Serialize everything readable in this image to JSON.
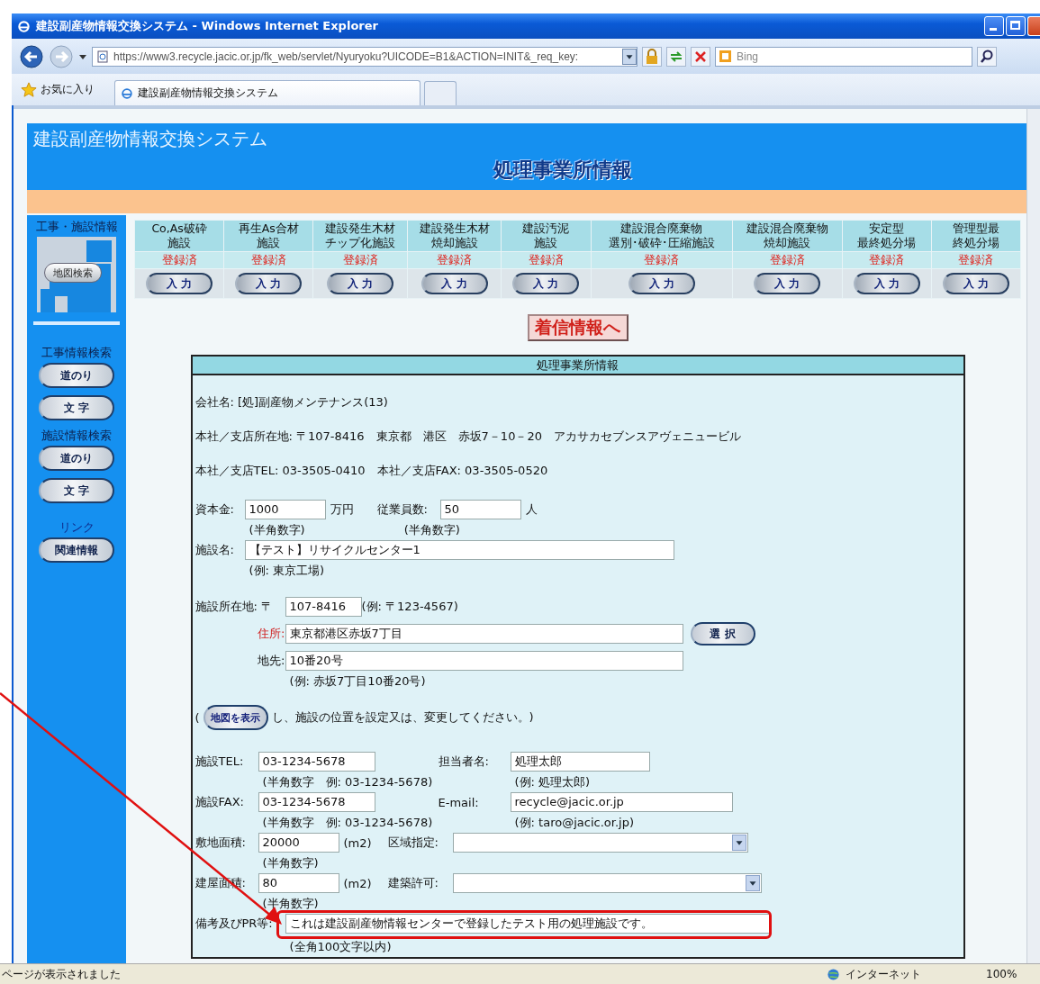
{
  "window": {
    "title": "建設副産物情報交換システム - Windows Internet Explorer"
  },
  "address_bar": {
    "url": "https://www3.recycle.jacic.or.jp/fk_web/servlet/Nyuryoku?UICODE=B1&ACTION=INIT&_req_key:",
    "search_placeholder": "Bing"
  },
  "favorites_bar": {
    "favorites": "お気に入り",
    "tabs": [
      {
        "label": "建設副産物情報交換システム",
        "selected": true
      }
    ]
  },
  "page": {
    "system_name": "建設副産物情報交換システム",
    "title": "処理事業所情報"
  },
  "sidebar": {
    "heading": "工事・施設情報",
    "map_button": "地図検索",
    "sections": [
      {
        "heading": "工事情報検索",
        "kind": "search",
        "buttons": [
          "道のり",
          "文 字"
        ]
      },
      {
        "heading": "施設情報検索",
        "kind": "search",
        "buttons": [
          "道のり",
          "文 字"
        ]
      },
      {
        "heading": "リンク",
        "kind": "link",
        "buttons": [
          "関連情報"
        ]
      }
    ]
  },
  "facility_types": [
    {
      "lines": [
        "Co,As破砕",
        "施設"
      ],
      "status": "登録済",
      "button": "入 力"
    },
    {
      "lines": [
        "再生As合材",
        "施設"
      ],
      "status": "登録済",
      "button": "入 力"
    },
    {
      "lines": [
        "建設発生木材",
        "チップ化施設"
      ],
      "status": "登録済",
      "button": "入 力"
    },
    {
      "lines": [
        "建設発生木材",
        "焼却施設"
      ],
      "status": "登録済",
      "button": "入 力"
    },
    {
      "lines": [
        "建設汚泥",
        "施設"
      ],
      "status": "登録済",
      "button": "入 力"
    },
    {
      "lines": [
        "建設混合廃棄物",
        "選別･破砕･圧縮施設"
      ],
      "status": "登録済",
      "button": "入 力"
    },
    {
      "lines": [
        "建設混合廃棄物",
        "焼却施設"
      ],
      "status": "登録済",
      "button": "入 力"
    },
    {
      "lines": [
        "安定型",
        "最終処分場"
      ],
      "status": "登録済",
      "button": "入 力"
    },
    {
      "lines": [
        "管理型最",
        "終処分場"
      ],
      "status": "登録済",
      "button": "入 力"
    }
  ],
  "incoming_button": "着信情報へ",
  "form": {
    "title": "処理事業所情報",
    "info_lines": [
      "会社名: [処]副産物メンテナンス(13)",
      "本社／支店所在地: 〒107-8416　東京都　港区　赤坂7－10－20　アカサカセブンスアヴェニュービル",
      "本社／支店TEL: 03-3505-0410　本社／支店FAX: 03-3505-0520"
    ],
    "capital": {
      "label": "資本金:",
      "value": "1000",
      "unit": "万円",
      "hint": "(半角数字)"
    },
    "employees": {
      "label": "従業員数:",
      "value": "50",
      "unit": "人",
      "hint": "(半角数字)"
    },
    "facility_name": {
      "label": "施設名:",
      "value": "【テスト】リサイクルセンター1",
      "hint": "(例: 東京工場)"
    },
    "postal": {
      "label": "施設所在地: 〒",
      "value": "107-8416",
      "hint": "(例: 〒123-4567)"
    },
    "address": {
      "label": "住所:",
      "value": "東京都港区赤坂7丁目",
      "button": "選 択",
      "required": true
    },
    "address_detail": {
      "label": "地先:",
      "value": "10番20号",
      "hint": "(例: 赤坂7丁目10番20号)"
    },
    "map_note": {
      "open": "(",
      "button": "地図を表示",
      "text": "し、施設の位置を設定又は、変更してください。)"
    },
    "tel": {
      "label": "施設TEL:",
      "value": "03-1234-5678",
      "hint": "(半角数字　例: 03-1234-5678)"
    },
    "contact": {
      "label": "担当者名:",
      "value": "処理太郎",
      "hint": "(例: 処理太郎)"
    },
    "fax": {
      "label": "施設FAX:",
      "value": "03-1234-5678",
      "hint": "(半角数字　例: 03-1234-5678)"
    },
    "email": {
      "label": "E-mail:",
      "value": "recycle@jacic.or.jp",
      "hint": "(例: taro@jacic.or.jp)"
    },
    "site_area": {
      "label": "敷地面積:",
      "value": "20000",
      "unit": "(m2)",
      "hint": "(半角数字)"
    },
    "zoning": {
      "label": "区域指定:"
    },
    "building_area": {
      "label": "建屋面積:",
      "value": "80",
      "unit": "(m2)",
      "hint": "(半角数字)"
    },
    "building_permit": {
      "label": "建築許可:"
    },
    "remarks": {
      "label": "備考及びPR等:",
      "value": "これは建設副産物情報センターで登録したテスト用の処理施設です。",
      "hint": "(全角100文字以内)",
      "highlighted": true
    }
  },
  "status_bar": {
    "message": "ページが表示されました",
    "zone": "インターネット",
    "zoom": "100%"
  }
}
